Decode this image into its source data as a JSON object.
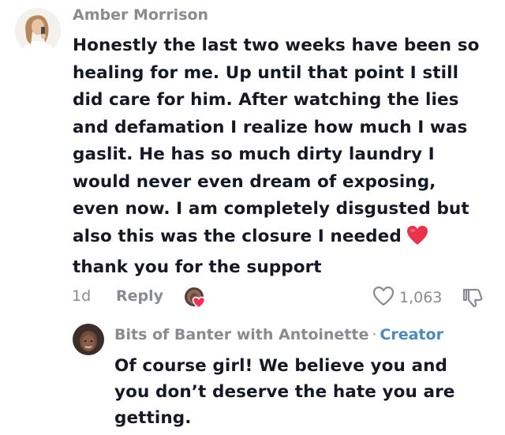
{
  "comment": {
    "username": "Amber Morrison",
    "lines": [
      "Honestly the last two weeks have been so",
      "healing for me. Up until that point I still",
      "did care for him. After watching the lies",
      "and defamation I realize how much I was",
      "gaslit. He has so much dirty laundry I",
      "would never even dream of exposing,",
      "even now. I am completely disgusted but",
      "also this was the closure I needed",
      "thank you for the support"
    ],
    "emoji": "red-heart",
    "time": "1d",
    "reply_label": "Reply",
    "like_count": "1,063"
  },
  "reply": {
    "username": "Bits of Banter with Antoinette",
    "separator": "·",
    "badge": "Creator",
    "lines": [
      "Of course girl! We believe you and",
      "you don’t deserve the hate you are",
      "getting."
    ]
  },
  "icons": {
    "like": "heart-outline-icon",
    "dislike": "thumbs-down-icon",
    "creator_liked": "creator-liked-avatar-icon"
  },
  "colors": {
    "text": "#161823",
    "muted": "#8a8b91",
    "creator_badge": "#4d8ab8",
    "heart": "#e8334a"
  }
}
